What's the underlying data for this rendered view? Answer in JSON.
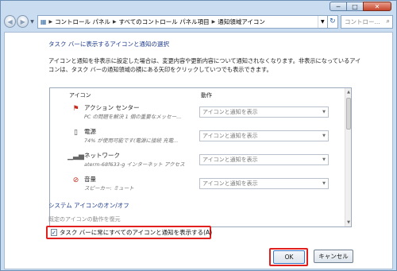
{
  "window": {
    "minimize_glyph": "─",
    "maximize_glyph": "□",
    "close_glyph": "✕"
  },
  "nav": {
    "breadcrumbs": [
      "コントロール パネル",
      "すべてのコントロール パネル項目",
      "通知領域アイコン"
    ],
    "search_placeholder": "コントロー..."
  },
  "main": {
    "heading": "タスク バーに表示するアイコンと通知の選択",
    "description": "アイコンと通知を非表示に設定した場合は、変更内容や更新内容について通知されなくなります。非表示になっているアイコンは、タスク バーの通知領域の横にある矢印をクリックしていつでも表示できます。",
    "list": {
      "col_icon": "アイコン",
      "col_behavior": "動作",
      "rows": [
        {
          "name": "アクション センター",
          "sub": "PC の問題を解決 1 個の重要なメッセー...",
          "behavior": "アイコンと通知を表示",
          "icon": "action-center-icon"
        },
        {
          "name": "電源",
          "sub": "74% が使用可能です(電源に接続 充電...",
          "behavior": "アイコンと通知を表示",
          "icon": "power-icon"
        },
        {
          "name": "ネットワーク",
          "sub": "aterm-68f633-g インターネット アクセス",
          "behavior": "アイコンと通知を表示",
          "icon": "network-icon"
        },
        {
          "name": "音量",
          "sub": "スピーカー: ミュート",
          "behavior": "アイコンと通知を表示",
          "icon": "volume-mute-icon"
        }
      ]
    },
    "sys_icons_link": "システム アイコンのオン/オフ",
    "restore_link": "既定のアイコンの動作を復元",
    "always_show_label": "タスク バーに常にすべてのアイコンと通知を表示する(A)",
    "always_show_checked": true
  },
  "footer": {
    "ok_label": "OK",
    "cancel_label": "キャンセル"
  },
  "colors": {
    "highlight": "#e0201e",
    "link": "#1e3c8c"
  }
}
